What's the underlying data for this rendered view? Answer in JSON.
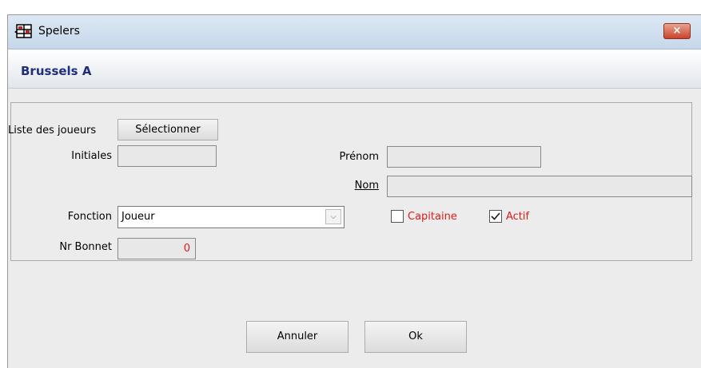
{
  "window": {
    "title": "Spelers",
    "close_glyph": "×"
  },
  "header": {
    "team_name": "Brussels A"
  },
  "form": {
    "players_list_label": "Liste des joueurs",
    "select_button_label": "Sélectionner",
    "initials_label": "Initiales",
    "initials_value": "",
    "firstname_label": "Prénom",
    "firstname_value": "",
    "name_label": "Nom",
    "name_value": "",
    "function_label": "Fonction",
    "function_value": "Joueur",
    "captain_label": "Capitaine",
    "captain_checked": false,
    "active_label": "Actif",
    "active_checked": true,
    "cap_number_label": "Nr Bonnet",
    "cap_number_value": "0"
  },
  "buttons": {
    "cancel_label": "Annuler",
    "ok_label": "Ok"
  },
  "colors": {
    "team_name": "#1f2f80",
    "checkbox_labels": "#e11a1a",
    "cap_number_value": "#e11a1a"
  }
}
